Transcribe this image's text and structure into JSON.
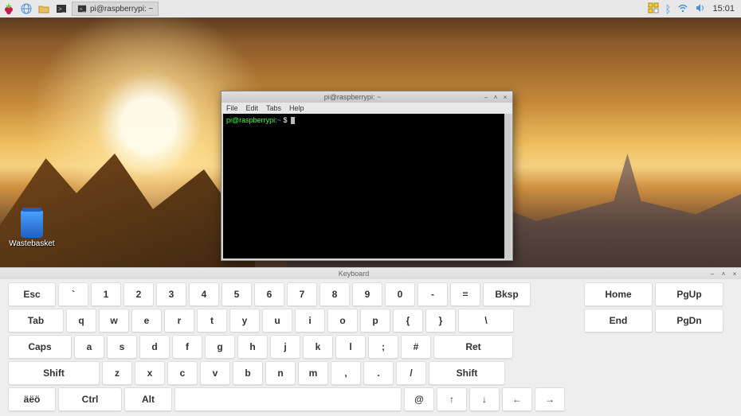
{
  "taskbar": {
    "task_button": "pi@raspberrypi: ~",
    "clock": "15:01"
  },
  "desktop": {
    "wastebasket": "Wastebasket"
  },
  "terminal": {
    "title": "pi@raspberrypi: ~",
    "menu": {
      "file": "File",
      "edit": "Edit",
      "tabs": "Tabs",
      "help": "Help"
    },
    "prompt_user": "pi@raspberrypi",
    "prompt_path": "~",
    "prompt_symbol": "$"
  },
  "keyboard": {
    "title": "Keyboard",
    "rows": {
      "r1": [
        "Esc",
        "`",
        "1",
        "2",
        "3",
        "4",
        "5",
        "6",
        "7",
        "8",
        "9",
        "0",
        "-",
        "=",
        "Bksp"
      ],
      "r2": [
        "Tab",
        "q",
        "w",
        "e",
        "r",
        "t",
        "y",
        "u",
        "i",
        "o",
        "p",
        "{",
        "}",
        "\\"
      ],
      "r3": [
        "Caps",
        "a",
        "s",
        "d",
        "f",
        "g",
        "h",
        "j",
        "k",
        "l",
        ";",
        "#",
        "Ret"
      ],
      "r4": [
        "Shift",
        "z",
        "x",
        "c",
        "v",
        "b",
        "n",
        "m",
        ",",
        ".",
        "/",
        "Shift"
      ],
      "r5": [
        "äëö",
        "Ctrl",
        "Alt",
        "",
        "@",
        "↑",
        "↓",
        "←",
        "→"
      ]
    },
    "nav": [
      "Home",
      "PgUp",
      "End",
      "PgDn"
    ]
  }
}
